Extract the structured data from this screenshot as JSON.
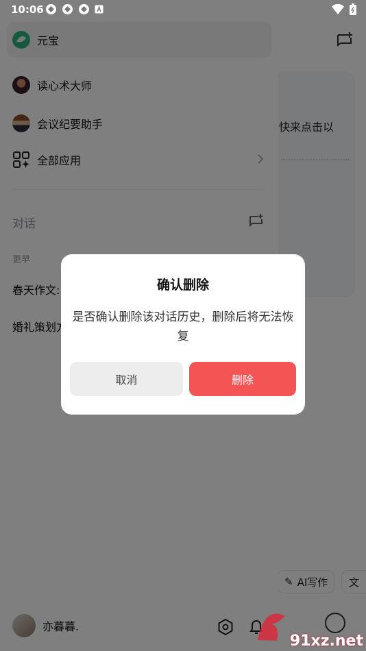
{
  "status_bar": {
    "time": "10:06"
  },
  "drawer": {
    "pinned": {
      "label": "元宝"
    },
    "agents": [
      {
        "label": "读心术大师"
      },
      {
        "label": "会议纪要助手"
      }
    ],
    "all_apps": {
      "label": "全部应用"
    },
    "section": {
      "title": "对话"
    },
    "history_group": {
      "label": "更早"
    },
    "history": [
      {
        "title": "春天作文:"
      },
      {
        "title": "婚礼策划方"
      }
    ],
    "user": {
      "name": "亦暮暮."
    }
  },
  "background_page": {
    "snippet": "快来点击以",
    "chips": [
      {
        "label": "AI写作"
      },
      {
        "label": ""
      }
    ]
  },
  "dialog": {
    "title": "确认删除",
    "message": "是否确认删除该对话历史，删除后将无法恢复",
    "cancel_label": "取消",
    "delete_label": "删除"
  },
  "watermark": {
    "text": "91xz.net"
  },
  "colors": {
    "danger": "#f55454",
    "overlay": "rgba(0,0,0,0.5)"
  }
}
